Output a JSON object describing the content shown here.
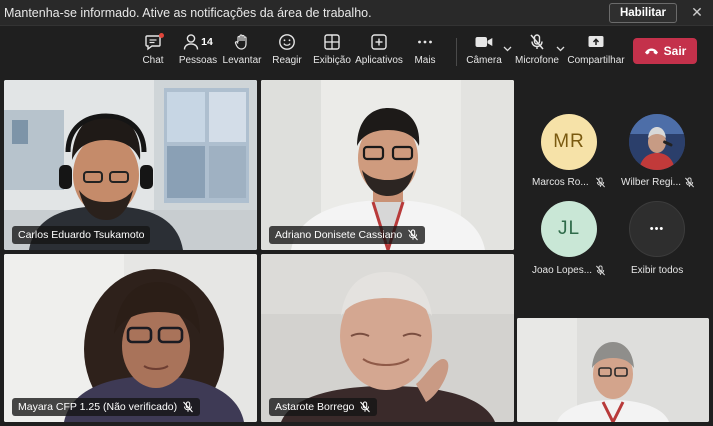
{
  "notification": {
    "text": "Mantenha-se informado. Ative as notificações da área de trabalho.",
    "enable_label": "Habilitar",
    "close_glyph": "✕"
  },
  "toolbar": {
    "chat": "Chat",
    "people": "Pessoas",
    "people_count": "14",
    "raise": "Levantar",
    "react": "Reagir",
    "view": "Exibição",
    "apps": "Aplicativos",
    "more": "Mais",
    "camera": "Câmera",
    "mic": "Microfone",
    "share": "Compartilhar",
    "leave": "Sair"
  },
  "participants": [
    {
      "name": "Carlos Eduardo Tsukamoto",
      "muted": false
    },
    {
      "name": "Adriano Donisete Cassiano",
      "muted": true
    },
    {
      "name": "Mayara CFP 1.25 (Não verificado)",
      "muted": true
    },
    {
      "name": "Astarote Borrego",
      "muted": true
    }
  ],
  "side_panel": {
    "p1": {
      "initials": "MR",
      "name": "Marcos Ro...",
      "color": "#f6e2a8",
      "text_color": "#7a5a10"
    },
    "p2": {
      "name": "Wilber Regi..."
    },
    "p3": {
      "initials": "JL",
      "name": "Joao Lopes...",
      "color": "#c9e7d6",
      "text_color": "#2f6b4a"
    },
    "show_all": "Exibir todos",
    "more_glyph": "•••"
  },
  "colors": {
    "leave_button": "#c4314b",
    "background": "#1f1f1f",
    "notification_dot": "#e0453a"
  }
}
